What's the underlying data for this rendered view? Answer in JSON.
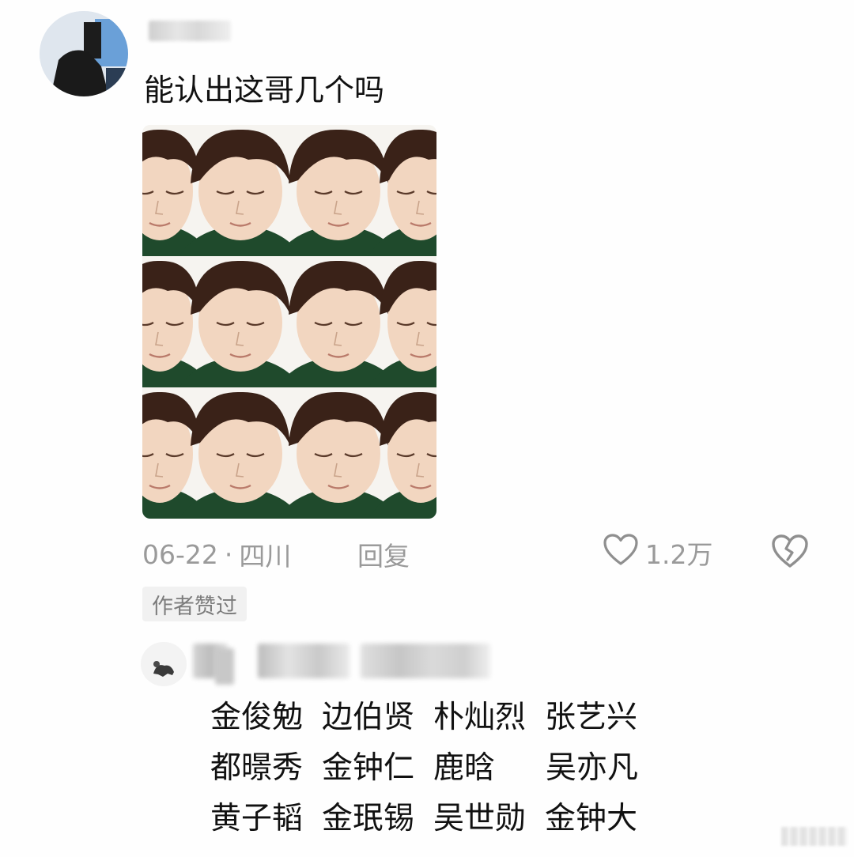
{
  "comment": {
    "text": "能认出这哥几个吗",
    "date": "06-22",
    "separator": "·",
    "location": "四川",
    "reply_label": "回复",
    "like_count": "1.2万",
    "author_badge": "作者赞过"
  },
  "reply": {
    "lines": [
      [
        "金俊勉",
        "边伯贤",
        "朴灿烈",
        "张艺兴"
      ],
      [
        "都暻秀",
        "金钟仁",
        "鹿晗",
        "吴亦凡"
      ],
      [
        "黄子韬",
        "金珉锡",
        "吴世勋",
        "金钟大"
      ]
    ]
  },
  "icons": {
    "like": "heart-outline-icon",
    "dislike": "broken-heart-icon"
  },
  "colors": {
    "meta_text": "#9a9a9a",
    "badge_bg": "#f1f1f1",
    "shirt": "#1f4a2c"
  }
}
